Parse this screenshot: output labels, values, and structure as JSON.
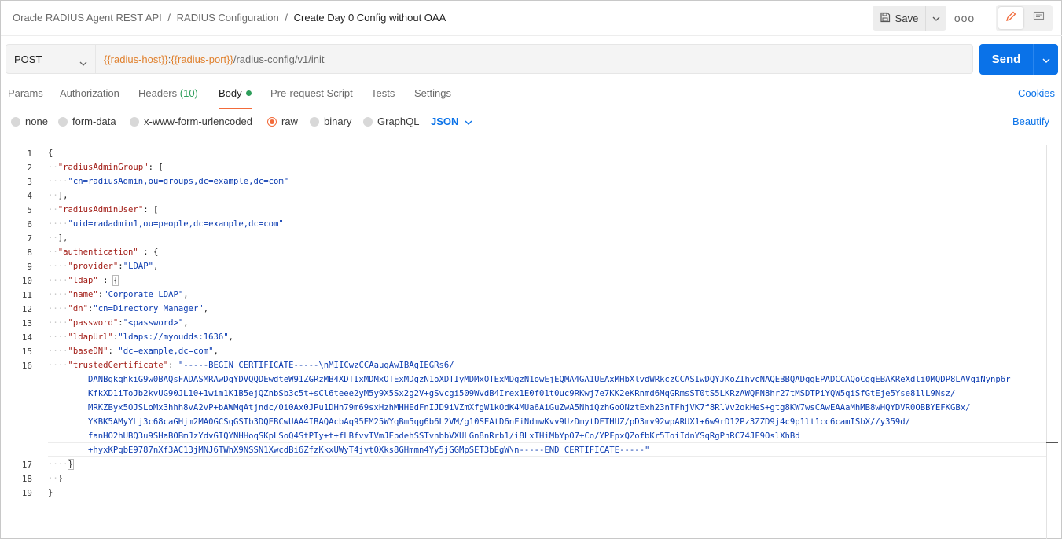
{
  "breadcrumb": {
    "parts": [
      "Oracle RADIUS Agent REST API",
      "RADIUS Configuration"
    ],
    "separator": "/",
    "current": "Create Day 0 Config without OAA"
  },
  "toolbar": {
    "save_label": "Save",
    "more_label": "ooo"
  },
  "request": {
    "method": "POST",
    "url_var_host": "{{radius-host}}",
    "url_colon": ":",
    "url_var_port": "{{radius-port}}",
    "url_path": "/radius-config/v1/init",
    "send_label": "Send"
  },
  "tabs": {
    "params": "Params",
    "authorization": "Authorization",
    "headers": "Headers",
    "headers_count": "(10)",
    "body": "Body",
    "prerequest": "Pre-request Script",
    "tests": "Tests",
    "settings": "Settings",
    "cookies": "Cookies"
  },
  "body_types": {
    "none": "none",
    "form_data": "form-data",
    "urlencoded": "x-www-form-urlencoded",
    "raw": "raw",
    "binary": "binary",
    "graphql": "GraphQL",
    "language": "JSON",
    "beautify": "Beautify"
  },
  "colors": {
    "accent": "#0a72e8",
    "orange": "#f26b3a",
    "var_orange": "#e0802d",
    "json_key": "#a3201a",
    "json_string": "#0b3bb0",
    "green": "#2e9e5b"
  },
  "editor": {
    "line_numbers": [
      "1",
      "2",
      "3",
      "4",
      "5",
      "6",
      "7",
      "8",
      "9",
      "10",
      "11",
      "12",
      "13",
      "14",
      "15",
      "16",
      "17",
      "18",
      "19"
    ],
    "l1": "{",
    "l2_key": "\"radiusAdminGroup\"",
    "l2_rest": ": [",
    "l3_val": "\"cn=radiusAdmin,ou=groups,dc=example,dc=com\"",
    "l4": "],",
    "l5_key": "\"radiusAdminUser\"",
    "l5_rest": ": [",
    "l6_val": "\"uid=radadmin1,ou=people,dc=example,dc=com\"",
    "l7": "],",
    "l8_key": "\"authentication\"",
    "l8_rest": " : {",
    "l9_key": "\"provider\"",
    "l9_val": "\"LDAP\"",
    "l10_key": "\"ldap\"",
    "l10_rest": " : ",
    "l10_brace": "{",
    "l11_key": "\"name\"",
    "l11_val": "\"Corporate LDAP\"",
    "l12_key": "\"dn\"",
    "l12_val": "\"cn=Directory Manager\"",
    "l13_key": "\"password\"",
    "l13_val": "\"<password>\"",
    "l14_key": "\"ldapUrl\"",
    "l14_val": "\"ldaps://myoudds:1636\"",
    "l15_key": "\"baseDN\"",
    "l15_val": "\"dc=example,dc=com\"",
    "l16_key": "\"trustedCertificate\"",
    "l16_val0": "\"-----BEGIN CERTIFICATE-----\\nMIICwzCCAaugAwIBAgIEGRs6/",
    "l16_val1": "DANBgkqhkiG9w0BAQsFADASMRAwDgYDVQQDEwdteW91ZGRzMB4XDTIxMDMxOTExMDgzN1oXDTIyMDMxOTExMDgzN1owEjEQMA4GA1UEAxMHbXlvdWRkczCCASIwDQYJKoZIhvcNAQEBBQADggEPADCCAQoCggEBAKReXdli0MQDP8LAVqiNynp6r",
    "l16_val2": "KfkXD1iToJb2kvUG90JL10+1wim1K1B5ejQZnbSb3c5t+sCl6teee2yM5y9X5Sx2g2V+gSvcgi509WvdB4Irex1E0f01t0uc9RKwj7e7KK2eKRnmd6MqGRmsST0tS5LKRzAWQFN8hr27tMSDTPiYQW5qiSfGtEje5Yse81lL9Nsz/",
    "l16_val3": "MRKZByx5OJSLoMx3hhh8vA2vP+bAWMqAtjndc/0i0Ax0JPu1DHn79m69sxHzhMHHEdFnIJD9iVZmXfgW1kOdK4MUa6AiGuZwA5NhiQzhGoONztExh23nTFhjVK7f8RlVv2okHeS+gtg8KW7wsCAwEAAaMhMB8wHQYDVR0OBBYEFKGBx/",
    "l16_val4": "YKBK5AMyYLj3c68caGHjm2MA0GCSqGSIb3DQEBCwUAA4IBAQAcbAq95EM25WYqBm5qg6b6L2VM/g10SEAtD6nFiNdmwKvv9UzDmytDETHUZ/pD3mv92wpARUX1+6w9rD12Pz3ZZD9j4c9p1lt1cc6camISbX//y359d/",
    "l16_val5": "fanHO2hUBQ3u9SHaBOBmJzYdvGIQYNHHoqSKpLSoQ4StPIy+t+fLBfvvTVmJEpdehSSTvnbbVXULGn8nRrb1/i8LxTHiMbYpO7+Co/YPFpxQZofbKr5ToiIdnYSqRgPnRC74JF9OslXhBd",
    "l16_val6": "+hyxKPqbE9787nXf3AC13jMNJ6TWhX9NSSN1XwcdBi6ZfzKkxUWyT4jvtQXks8GHmmn4Yy5jGGMpSET3bEgW\\n-----END CERTIFICATE-----\"",
    "l17": "}",
    "l18": "}",
    "l19": "}"
  }
}
